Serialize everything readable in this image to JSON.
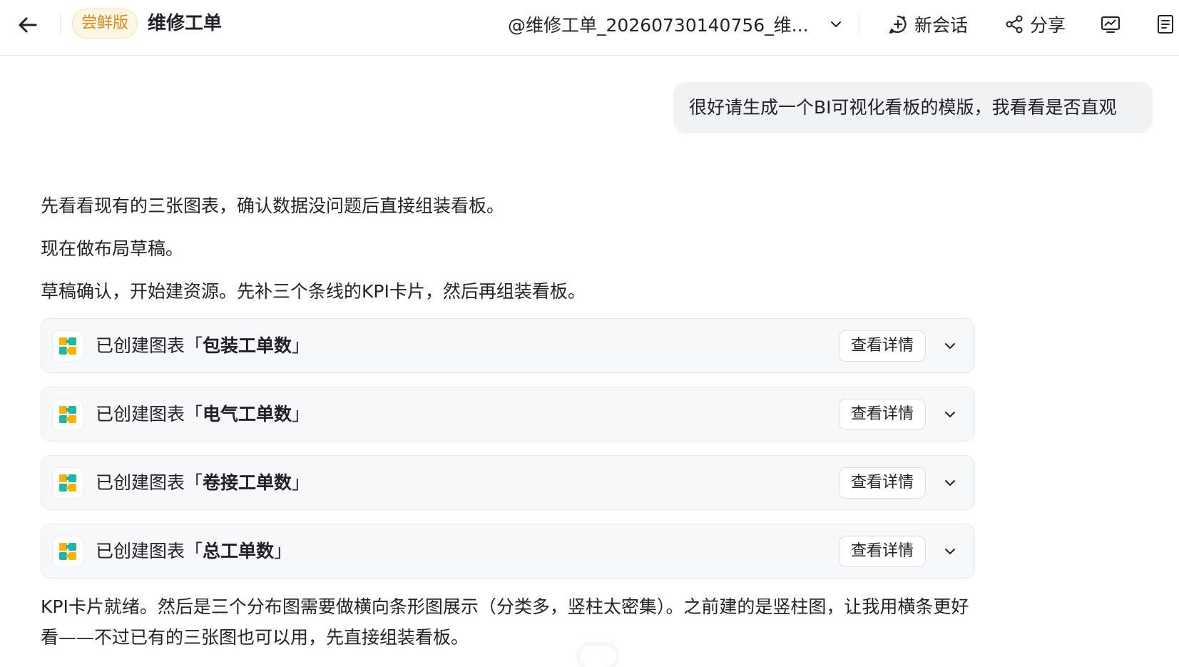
{
  "header": {
    "badge": "尝鲜版",
    "title": "维修工单",
    "session_name": "@维修工单_20260730140756_维...",
    "new_chat_label": "新会话",
    "share_label": "分享"
  },
  "conversation": {
    "user_message": "很好请生成一个BI可视化看板的模版，我看看是否直观",
    "assistant_paragraphs": [
      "先看看现有的三张图表，确认数据没问题后直接组装看板。",
      "现在做布局草稿。",
      "草稿确认，开始建资源。先补三个条线的KPI卡片，然后再组装看板。"
    ],
    "cards": [
      {
        "prefix": "已创建图表「",
        "name": "包装工单数",
        "suffix": "」",
        "button": "查看详情"
      },
      {
        "prefix": "已创建图表「",
        "name": "电气工单数",
        "suffix": "」",
        "button": "查看详情"
      },
      {
        "prefix": "已创建图表「",
        "name": "卷接工单数",
        "suffix": "」",
        "button": "查看详情"
      },
      {
        "prefix": "已创建图表「",
        "name": "总工单数",
        "suffix": "」",
        "button": "查看详情"
      }
    ],
    "closing_paragraph": "KPI卡片就绪。然后是三个分布图需要做横向条形图展示（分类多，竖柱太密集）。之前建的是竖柱图，让我用横条更好看——不过已有的三张图也可以用，先直接组装看板。"
  },
  "colors": {
    "badge_text": "#d88a1d",
    "badge_bg": "#fff6e3",
    "card_bg": "#f7f8fa",
    "user_bubble_bg": "#f1f2f4"
  },
  "icons": [
    "back-arrow-icon",
    "chevron-down-icon",
    "new-chat-icon",
    "share-icon",
    "monitor-icon",
    "document-icon",
    "chart-puzzle-icon"
  ]
}
